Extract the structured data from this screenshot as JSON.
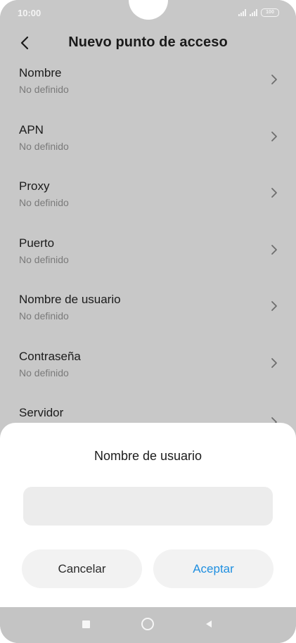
{
  "status_bar": {
    "time": "10:00",
    "battery": "100"
  },
  "header": {
    "title": "Nuevo punto de acceso"
  },
  "settings": [
    {
      "label": "Nombre",
      "value": "No definido"
    },
    {
      "label": "APN",
      "value": "No definido"
    },
    {
      "label": "Proxy",
      "value": "No definido"
    },
    {
      "label": "Puerto",
      "value": "No definido"
    },
    {
      "label": "Nombre de usuario",
      "value": "No definido"
    },
    {
      "label": "Contraseña",
      "value": "No definido"
    },
    {
      "label": "Servidor",
      "value": ""
    }
  ],
  "dialog": {
    "title": "Nombre de usuario",
    "input_value": "",
    "cancel_label": "Cancelar",
    "accept_label": "Aceptar"
  },
  "colors": {
    "accent": "#1f8fe0",
    "background_dimmed": "#c8c8c8",
    "sheet": "#ffffff"
  },
  "icons": {
    "back": "chevron-left-icon",
    "row": "chevron-right-icon",
    "nav_recent": "square-icon",
    "nav_home": "circle-icon",
    "nav_back": "triangle-left-icon"
  }
}
